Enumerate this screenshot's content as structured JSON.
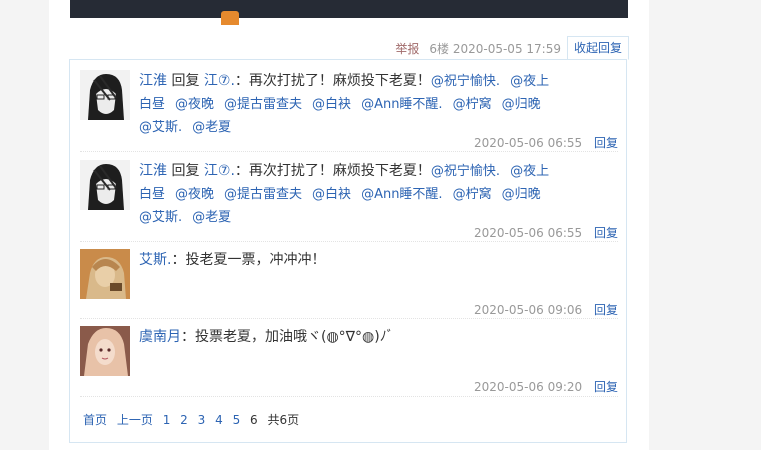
{
  "post_meta": {
    "report_label": "举报",
    "floor_time": "6楼 2020-05-05 17:59",
    "collapse_label": "收起回复"
  },
  "replies": [
    {
      "user": "江淮",
      "reply_word": "回复",
      "target": "江⑦.",
      "colon": "：",
      "text": "再次打扰了！麻烦投下老夏！",
      "mentions": [
        "@祝宁愉快.",
        "@夜上白昼",
        "@夜晚",
        "@提古雷查夫",
        "@白袂",
        "@Ann睡不醒.",
        "@柠窝",
        "@归晚",
        "@艾斯.",
        "@老夏"
      ],
      "time": "2020-05-06 06:55",
      "reply_label": "回复"
    },
    {
      "user": "江淮",
      "reply_word": "回复",
      "target": "江⑦.",
      "colon": "：",
      "text": "再次打扰了！麻烦投下老夏！",
      "mentions": [
        "@祝宁愉快.",
        "@夜上白昼",
        "@夜晚",
        "@提古雷查夫",
        "@白袂",
        "@Ann睡不醒.",
        "@柠窝",
        "@归晚",
        "@艾斯.",
        "@老夏"
      ],
      "time": "2020-05-06 06:55",
      "reply_label": "回复"
    },
    {
      "user": "艾斯.",
      "colon": "：",
      "text": "投老夏一票，冲冲冲！",
      "time": "2020-05-06 09:06",
      "reply_label": "回复"
    },
    {
      "user": "虞南月",
      "colon": "：",
      "text": "投票老夏，加油哦ヾ(◍°∇°◍)ﾉﾞ",
      "time": "2020-05-06 09:20",
      "reply_label": "回复"
    }
  ],
  "pager": {
    "first": "首页",
    "prev": "上一页",
    "pages": [
      "1",
      "2",
      "3",
      "4",
      "5"
    ],
    "current": "6",
    "total": "共6页"
  }
}
